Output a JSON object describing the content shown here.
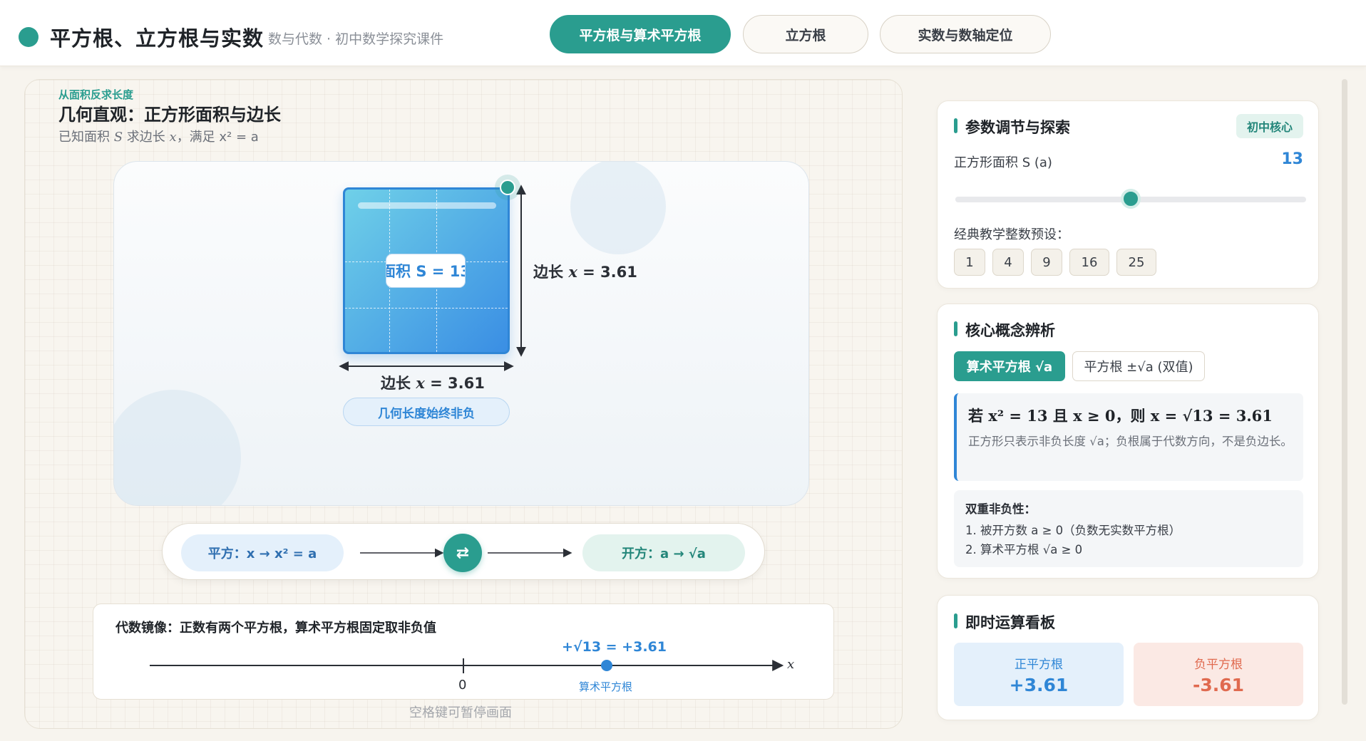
{
  "header": {
    "title": "平方根、立方根与实数",
    "subtitle": "数与代数 · 初中数学探究课件",
    "tabs": [
      {
        "label": "平方根与算术平方根",
        "active": true
      },
      {
        "label": "立方根",
        "active": false
      },
      {
        "label": "实数与数轴定位",
        "active": false
      }
    ]
  },
  "stage": {
    "eyebrow": "从面积反求长度",
    "title": "几何直观：正方形面积与边长",
    "desc_prefix": "已知面积 ",
    "desc_S": "S",
    "desc_mid": " 求边长 ",
    "desc_x": "x",
    "desc_suffix": "，满足 x² = a",
    "area_label": "面积 S = 13",
    "side_right_prefix": "边长 ",
    "side_var": "x",
    "side_value": " = 3.61",
    "side_bottom_prefix": "边长 ",
    "nonneg_note": "几何长度始终非负",
    "flow": {
      "left": "平方：x → x² = a",
      "swap_icon": "⇄",
      "right": "开方：a → √a"
    },
    "mirror": {
      "title": "代数镜像：正数有两个平方根，算术平方根固定取非负值",
      "zero": "0",
      "axis_var": "x",
      "value_label": "+√13 = +3.61",
      "point_label": "算术平方根"
    },
    "pause_hint": "空格键可暂停画面"
  },
  "params": {
    "title": "参数调节与探索",
    "badge": "初中核心",
    "area_label": "正方形面积 S (a)",
    "area_value": "13",
    "slider_fraction": 0.5,
    "presets_label": "经典教学整数预设：",
    "presets": [
      "1",
      "4",
      "9",
      "16",
      "25"
    ]
  },
  "concepts": {
    "title": "核心概念辨析",
    "tabs": [
      {
        "label": "算术平方根 √a",
        "active": true
      },
      {
        "label": "平方根 ±√a (双值)",
        "active": false
      }
    ],
    "statement": "若 x² = 13 且 x ≥ 0，则 x = √13 = 3.61",
    "explain": "正方形只表示非负长度 √a；负根属于代数方向，不是负边长。",
    "double_title": "双重非负性：",
    "double_items": [
      "1. 被开方数 a ≥ 0（负数无实数平方根）",
      "2. 算术平方根 √a ≥ 0"
    ]
  },
  "calc": {
    "title": "即时运算看板",
    "pos_label": "正平方根",
    "pos_value": "+3.61",
    "neg_label": "负平方根",
    "neg_value": "-3.61"
  },
  "colors": {
    "accent": "#2a9d8f",
    "blue": "#2f86d6",
    "negative": "#e06a4f"
  }
}
